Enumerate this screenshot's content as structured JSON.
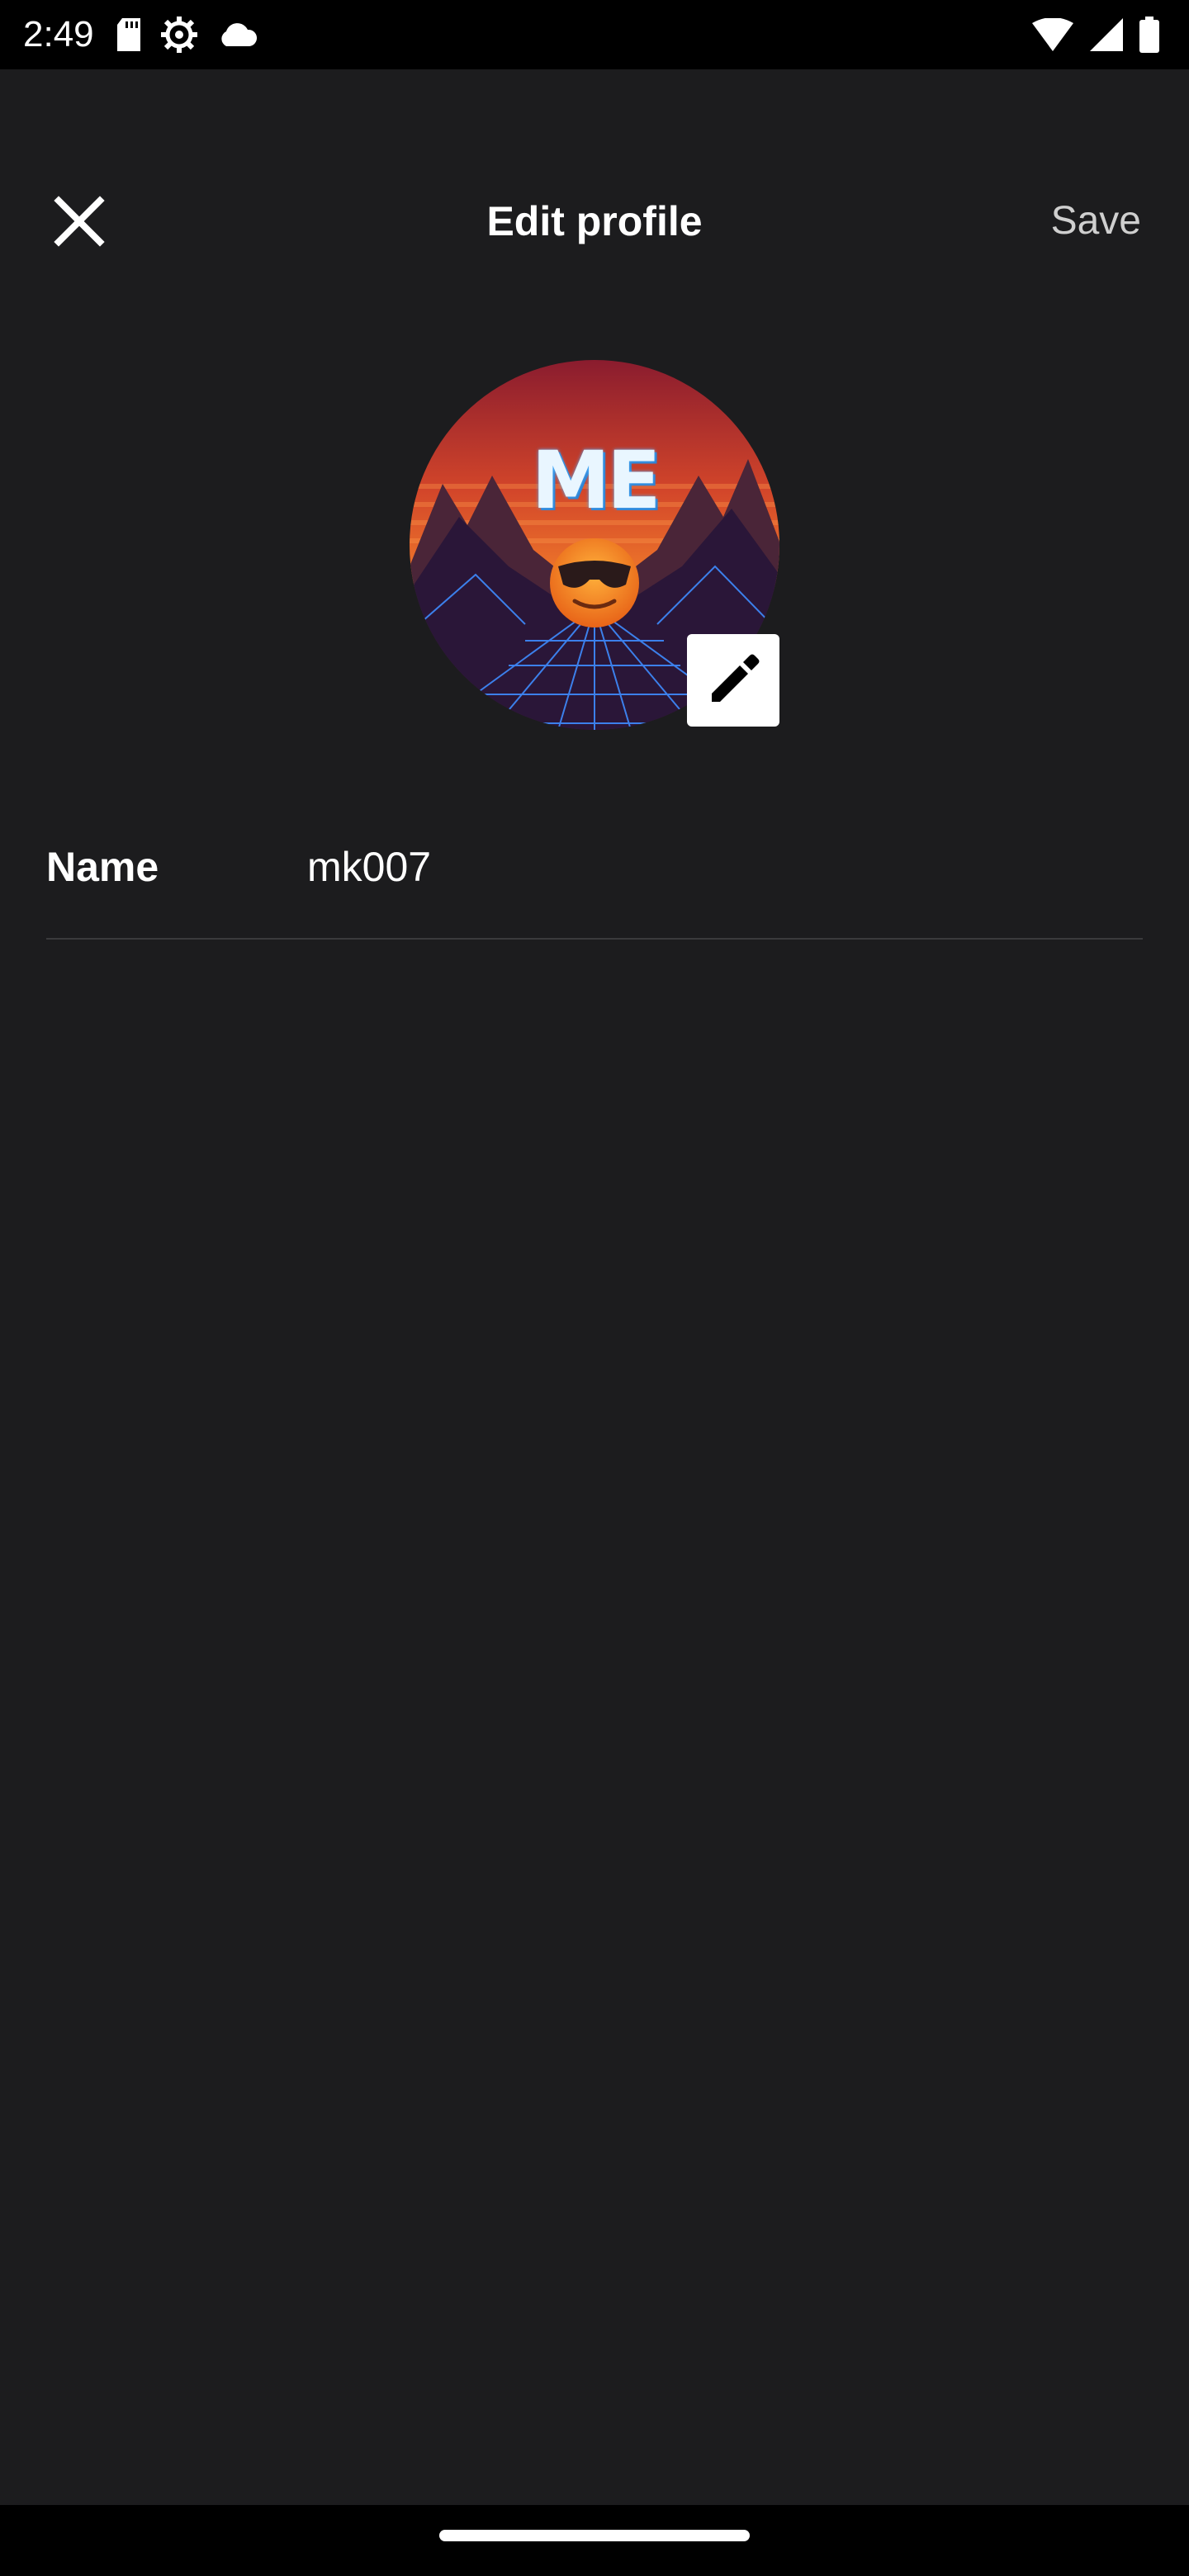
{
  "status_bar": {
    "time": "2:49",
    "left_icons": [
      "sd-card-icon",
      "settings-gear-icon",
      "cloud-icon"
    ],
    "right_icons": [
      "wifi-icon",
      "cell-signal-icon",
      "battery-icon"
    ]
  },
  "app_bar": {
    "close_icon": "close-icon",
    "title": "Edit profile",
    "save_label": "Save"
  },
  "avatar": {
    "image_text": "ME",
    "edit_icon": "pencil-icon"
  },
  "form": {
    "name_label": "Name",
    "name_value": "mk007"
  },
  "colors": {
    "background": "#1c1c1e",
    "status_bar": "#000000",
    "divider": "#3a3a3c",
    "save_text": "#cfcfcf"
  }
}
